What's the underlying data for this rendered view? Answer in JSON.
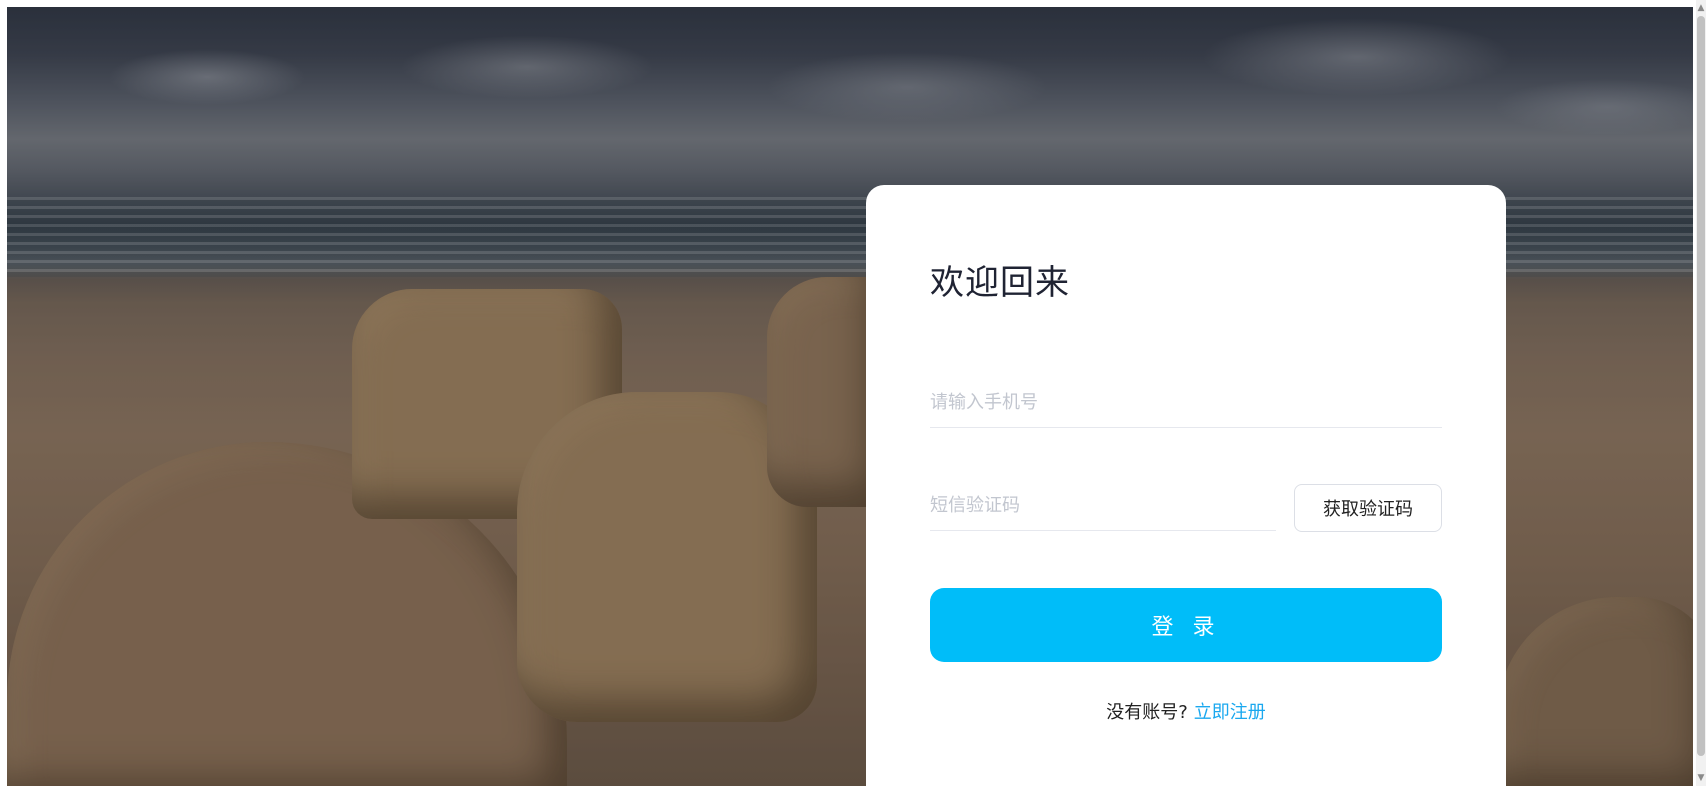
{
  "login": {
    "title": "欢迎回来",
    "phone_placeholder": "请输入手机号",
    "code_placeholder": "短信验证码",
    "get_code_label": "获取验证码",
    "submit_label": "登 录",
    "no_account_text": "没有账号?",
    "register_link": "立即注册"
  },
  "colors": {
    "primary": "#00bdf9",
    "link": "#1aa8ef",
    "title": "#1f2333"
  },
  "icons": {
    "scroll_up": "triangle-up-icon",
    "scroll_down": "triangle-down-icon"
  }
}
